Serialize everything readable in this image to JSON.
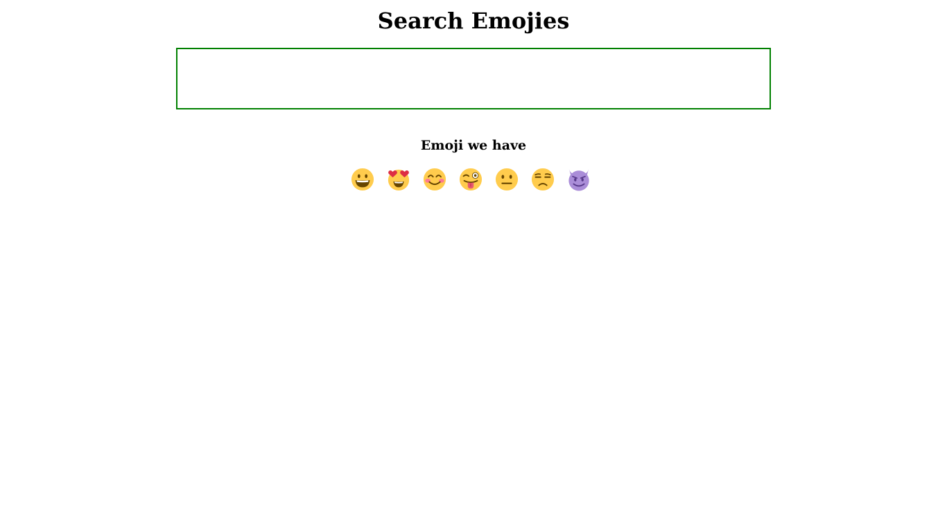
{
  "header": {
    "title": "Search Emojies"
  },
  "search": {
    "value": "",
    "placeholder": "",
    "border_color": "#008000"
  },
  "emoji_section": {
    "heading": "Emoji we have",
    "items": [
      {
        "name": "grinning-face",
        "char": "😀"
      },
      {
        "name": "smiling-face-with-heart-eyes",
        "char": "😍"
      },
      {
        "name": "smiling-face-with-smiling-eyes",
        "char": "😊"
      },
      {
        "name": "winking-face-with-tongue",
        "char": "😜"
      },
      {
        "name": "neutral-face",
        "char": "😐"
      },
      {
        "name": "unamused-face",
        "char": "😒"
      },
      {
        "name": "smiling-face-with-horns",
        "char": "😈"
      }
    ]
  },
  "colors": {
    "emoji_yellow": "#FFCC4D",
    "emoji_features": "#664500",
    "heart_red": "#DD2E44",
    "blush": "#FF7892",
    "tongue": "#E75A70",
    "devil_purple": "#AA8DD8"
  }
}
